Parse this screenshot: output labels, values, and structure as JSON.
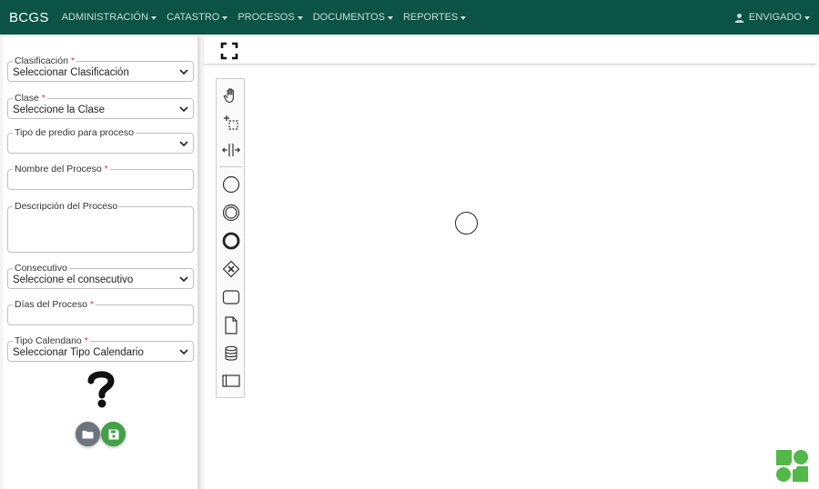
{
  "navbar": {
    "brand": "BCGS",
    "items": [
      "ADMINISTRACIÓN",
      "CATASTRO",
      "PROCESOS",
      "DOCUMENTOS",
      "REPORTES"
    ],
    "user": "ENVIGADO",
    "background_color": "#0b5445"
  },
  "form": {
    "clasificacion": {
      "label": "Clasificación",
      "value": "Seleccionar Clasificación",
      "required": true
    },
    "clase": {
      "label": "Clase",
      "value": "Seleccione la Clase",
      "required": true
    },
    "tipo_predio": {
      "label": "Tipo de predio para proceso",
      "value": "",
      "required": false
    },
    "nombre": {
      "label": "Nombre del Proceso",
      "value": "",
      "required": true
    },
    "descripcion": {
      "label": "Descripción del Proceso",
      "value": "",
      "required": false
    },
    "consecutivo": {
      "label": "Consecutivo",
      "value": "Seleccione el consecutivo",
      "required": false
    },
    "dias": {
      "label": "Días del Proceso",
      "value": "",
      "required": true
    },
    "tipo_calendario": {
      "label": "Tipo Calendario",
      "value": "Seleccionar Tipo Calendario",
      "required": true
    },
    "required_marker": "*"
  },
  "icons": {
    "help": "question-mark-icon",
    "folder": "folder-icon",
    "save": "floppy-disk-icon",
    "fullscreen": "fullscreen-icon",
    "palette": [
      "hand-tool-icon",
      "lasso-tool-icon",
      "space-tool-icon",
      "start-event-icon",
      "intermediate-event-icon",
      "end-event-icon",
      "gateway-icon",
      "task-icon",
      "data-object-icon",
      "data-store-icon",
      "pool-icon"
    ]
  },
  "colors": {
    "required": "#e53935",
    "folder_button": "#6c757d",
    "save_button": "#43a047",
    "logo": "#52b848"
  }
}
